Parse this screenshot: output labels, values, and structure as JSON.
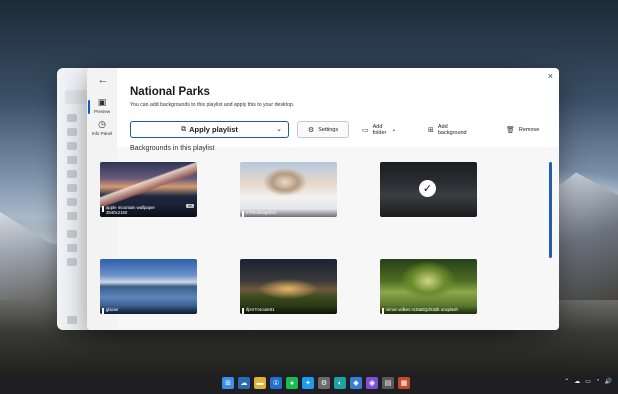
{
  "dialog": {
    "title": "National Parks",
    "subtitle": "You can add backgrounds to this playlist and apply this to your desktop.",
    "close_glyph": "×"
  },
  "rail": {
    "back_glyph": "←",
    "items": [
      {
        "label": "Preview",
        "icon": "preview-icon",
        "glyph": "▣"
      },
      {
        "label": "Info Panel",
        "icon": "clock-icon",
        "glyph": "◷"
      }
    ]
  },
  "toolbar": {
    "apply_label": "Apply playlist",
    "apply_icon_glyph": "⧉",
    "apply_chevron": "⌄",
    "settings_label": "Settings",
    "settings_glyph": "⚙",
    "add_folder_label": "Add folder",
    "add_folder_glyph": "▭",
    "add_folder_chevron": "⌄",
    "add_background_label": "Add background",
    "add_background_glyph": "⊞",
    "remove_label": "Remove",
    "remove_glyph": "🗑"
  },
  "section_label": "Backgrounds in this playlist",
  "backgrounds": [
    {
      "name": "apple mountain wallpaper",
      "size": "3840x2160",
      "badge": "4K",
      "selected": false
    },
    {
      "name": "x7hmufu0g0k41",
      "size": "",
      "badge": "",
      "selected": false
    },
    {
      "name": "",
      "size": "",
      "badge": "",
      "selected": true,
      "check_glyph": "✓"
    },
    {
      "name": "glacier",
      "size": "",
      "badge": "",
      "selected": false
    },
    {
      "name": "ifpm7n4ou5r61",
      "size": "",
      "badge": "",
      "selected": false
    },
    {
      "name": "simon wilkes m3taBQdS3dk unsplash",
      "size": "",
      "badge": "",
      "selected": false
    }
  ],
  "taskbar": {
    "apps": [
      {
        "name": "start-icon",
        "glyph": "⊞",
        "color": "#3a8ee6"
      },
      {
        "name": "widgets-icon",
        "glyph": "☁",
        "color": "#2b6cb0"
      },
      {
        "name": "file-explorer-icon",
        "glyph": "▬",
        "color": "#e0b23a"
      },
      {
        "name": "onepassword-icon",
        "glyph": "①",
        "color": "#1f6fd1"
      },
      {
        "name": "spotify-icon",
        "glyph": "●",
        "color": "#1db954"
      },
      {
        "name": "twitter-icon",
        "glyph": "✦",
        "color": "#1d9bf0"
      },
      {
        "name": "settings-icon",
        "glyph": "⚙",
        "color": "#6b6b6b"
      },
      {
        "name": "edge-icon",
        "glyph": "◐",
        "color": "#1fa3a1"
      },
      {
        "name": "photos-icon",
        "glyph": "◆",
        "color": "#3a7bd5"
      },
      {
        "name": "app-icon",
        "glyph": "◉",
        "color": "#7b4fd6"
      },
      {
        "name": "notes-icon",
        "glyph": "▤",
        "color": "#5a5a5a"
      },
      {
        "name": "backgrounds-app-icon",
        "glyph": "▦",
        "color": "#c44a2a"
      }
    ],
    "tray": [
      "⌃",
      "☁",
      "▭",
      "◔",
      "🔊"
    ]
  }
}
